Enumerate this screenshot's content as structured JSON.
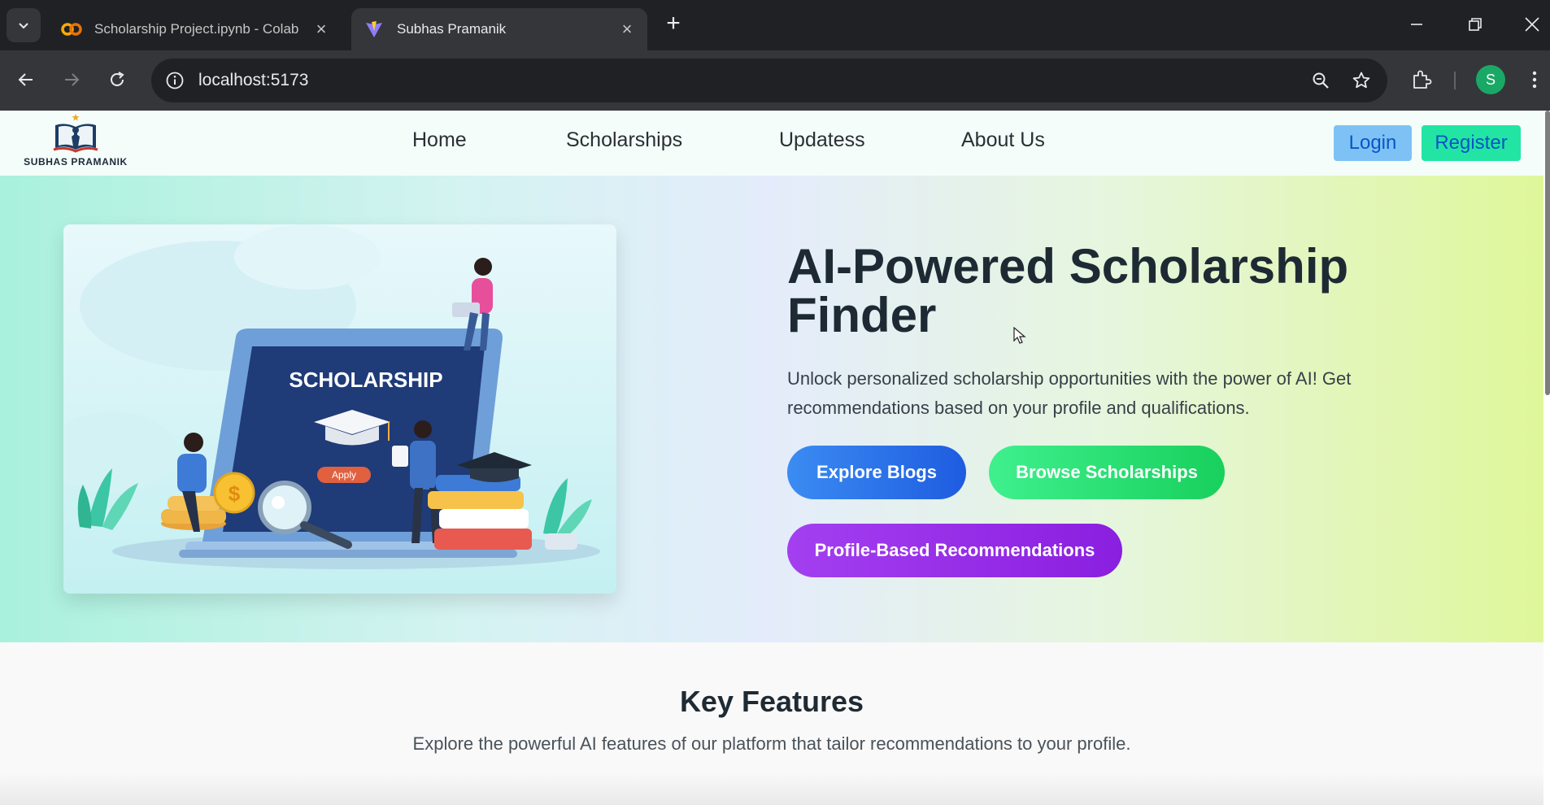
{
  "browser": {
    "tabs": [
      {
        "title": "Scholarship Project.ipynb - Colab",
        "favicon": "colab-icon",
        "active": false
      },
      {
        "title": "Subhas Pramanik",
        "favicon": "vite-icon",
        "active": true
      }
    ],
    "url": "localhost:5173",
    "profile_initial": "S"
  },
  "navbar": {
    "brand": "SUBHAS PRAMANIK",
    "links": [
      "Home",
      "Scholarships",
      "Updatess",
      "About Us"
    ],
    "login_label": "Login",
    "register_label": "Register"
  },
  "hero": {
    "title": "AI-Powered Scholarship Finder",
    "description": "Unlock personalized scholarship opportunities with the power of AI! Get recommendations based on your profile and qualifications.",
    "illustration": {
      "heading": "SCHOLARSHIP",
      "apply_label": "Apply"
    },
    "buttons": {
      "explore_blogs": "Explore Blogs",
      "browse_scholarships": "Browse Scholarships",
      "profile_recommendations": "Profile-Based Recommendations"
    }
  },
  "features": {
    "title": "Key Features",
    "subtitle": "Explore the powerful AI features of our platform that tailor recommendations to your profile."
  },
  "colors": {
    "login_bg": "#7ec2f5",
    "register_bg": "#22e5a4",
    "explore_btn": "#2d74ea",
    "browse_btn": "#2ee574",
    "profile_btn": "#9a2ff0"
  }
}
